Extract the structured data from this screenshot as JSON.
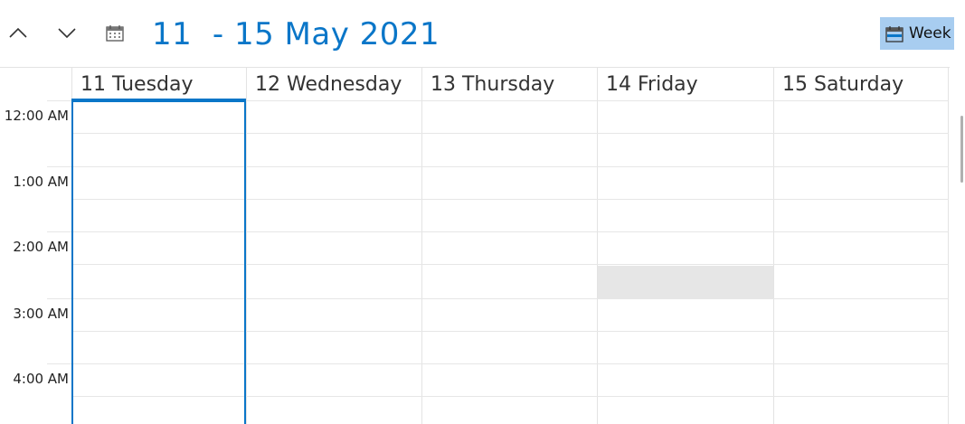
{
  "toolbar": {
    "prev_icon": "chevron-up-icon",
    "next_icon": "chevron-down-icon",
    "today_icon": "calendar-icon",
    "title": "11  - 15 May 2021",
    "view_label": "Week",
    "accent_color": "#0a76c8",
    "view_button_bg": "#a8cdf0"
  },
  "days": [
    {
      "label": "11 Tuesday"
    },
    {
      "label": "12 Wednesday"
    },
    {
      "label": "13 Thursday"
    },
    {
      "label": "14 Friday"
    },
    {
      "label": "15 Saturday"
    }
  ],
  "times": [
    "12:00 AM",
    "1:00 AM",
    "2:00 AM",
    "3:00 AM",
    "4:00 AM"
  ]
}
